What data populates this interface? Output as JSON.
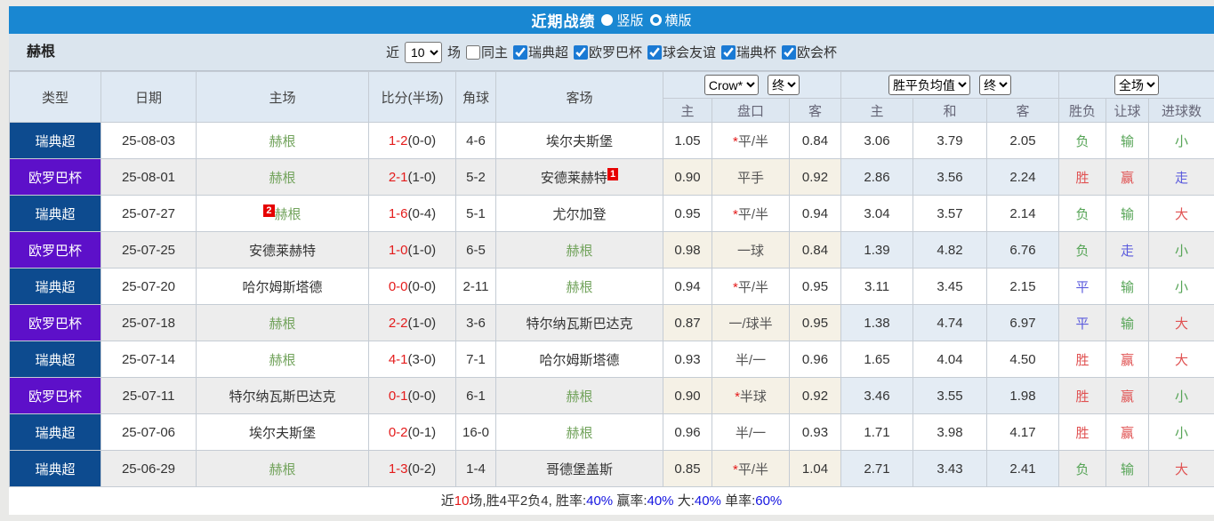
{
  "banner": {
    "title": "近期战绩",
    "vertical_label": "竖版",
    "horizontal_label": "横版"
  },
  "filter": {
    "team": "赫根",
    "near_label": "近",
    "count_value": "10",
    "games_label": "场",
    "same_home_label": "同主",
    "leagues": [
      "瑞典超",
      "欧罗巴杯",
      "球会友谊",
      "瑞典杯",
      "欧会杯"
    ]
  },
  "header": {
    "type": "类型",
    "date": "日期",
    "home": "主场",
    "score": "比分(半场)",
    "corner": "角球",
    "away": "客场",
    "odds_source": "Crow*",
    "asia_period": "终",
    "avg_source": "胜平负均值",
    "avg_period": "终",
    "scope": "全场",
    "sub": {
      "a_home": "主",
      "a_handicap": "盘口",
      "a_away": "客",
      "e_home": "主",
      "e_draw": "和",
      "e_away": "客",
      "wdl": "胜负",
      "let": "让球",
      "goals": "进球数"
    }
  },
  "league_colors": {
    "瑞典超": "#0d4b8f",
    "欧罗巴杯": "#5d10c9"
  },
  "table": {
    "rows": [
      {
        "league": "瑞典超",
        "date": "25-08-03",
        "home": {
          "name": "赫根",
          "is_team": true
        },
        "score": {
          "full": "1-2",
          "half": "(0-0)"
        },
        "corner": "4-6",
        "away": {
          "name": "埃尔夫斯堡",
          "is_team": false
        },
        "asia": {
          "home": "1.05",
          "star": true,
          "handicap": "平/半",
          "away": "0.84"
        },
        "avg": {
          "home": "3.06",
          "draw": "3.79",
          "away": "2.05"
        },
        "result": {
          "wdl": "负",
          "wdl_c": "green",
          "let": "输",
          "let_c": "green",
          "goals": "小",
          "goals_c": "green"
        }
      },
      {
        "league": "欧罗巴杯",
        "date": "25-08-01",
        "home": {
          "name": "赫根",
          "is_team": true
        },
        "score": {
          "full": "2-1",
          "half": "(1-0)"
        },
        "corner": "5-2",
        "away": {
          "name": "安德莱赫特",
          "is_team": false,
          "card": "1",
          "card_pos": "after"
        },
        "asia": {
          "home": "0.90",
          "star": false,
          "handicap": "平手",
          "away": "0.92"
        },
        "avg": {
          "home": "2.86",
          "draw": "3.56",
          "away": "2.24"
        },
        "result": {
          "wdl": "胜",
          "wdl_c": "red",
          "let": "赢",
          "let_c": "red",
          "goals": "走",
          "goals_c": "blue"
        }
      },
      {
        "league": "瑞典超",
        "date": "25-07-27",
        "home": {
          "name": "赫根",
          "is_team": true,
          "card": "2",
          "card_pos": "before"
        },
        "score": {
          "full": "1-6",
          "half": "(0-4)"
        },
        "corner": "5-1",
        "away": {
          "name": "尤尔加登",
          "is_team": false
        },
        "asia": {
          "home": "0.95",
          "star": true,
          "handicap": "平/半",
          "away": "0.94"
        },
        "avg": {
          "home": "3.04",
          "draw": "3.57",
          "away": "2.14"
        },
        "result": {
          "wdl": "负",
          "wdl_c": "green",
          "let": "输",
          "let_c": "green",
          "goals": "大",
          "goals_c": "red"
        }
      },
      {
        "league": "欧罗巴杯",
        "date": "25-07-25",
        "home": {
          "name": "安德莱赫特",
          "is_team": false
        },
        "score": {
          "full": "1-0",
          "half": "(1-0)"
        },
        "corner": "6-5",
        "away": {
          "name": "赫根",
          "is_team": true
        },
        "asia": {
          "home": "0.98",
          "star": false,
          "handicap": "一球",
          "away": "0.84"
        },
        "avg": {
          "home": "1.39",
          "draw": "4.82",
          "away": "6.76"
        },
        "result": {
          "wdl": "负",
          "wdl_c": "green",
          "let": "走",
          "let_c": "blue",
          "goals": "小",
          "goals_c": "green"
        }
      },
      {
        "league": "瑞典超",
        "date": "25-07-20",
        "home": {
          "name": "哈尔姆斯塔德",
          "is_team": false
        },
        "score": {
          "full": "0-0",
          "half": "(0-0)"
        },
        "corner": "2-11",
        "away": {
          "name": "赫根",
          "is_team": true
        },
        "asia": {
          "home": "0.94",
          "star": true,
          "handicap": "平/半",
          "away": "0.95"
        },
        "avg": {
          "home": "3.11",
          "draw": "3.45",
          "away": "2.15"
        },
        "result": {
          "wdl": "平",
          "wdl_c": "blue",
          "let": "输",
          "let_c": "green",
          "goals": "小",
          "goals_c": "green"
        }
      },
      {
        "league": "欧罗巴杯",
        "date": "25-07-18",
        "home": {
          "name": "赫根",
          "is_team": true
        },
        "score": {
          "full": "2-2",
          "half": "(1-0)"
        },
        "corner": "3-6",
        "away": {
          "name": "特尔纳瓦斯巴达克",
          "is_team": false
        },
        "asia": {
          "home": "0.87",
          "star": false,
          "handicap": "一/球半",
          "away": "0.95"
        },
        "avg": {
          "home": "1.38",
          "draw": "4.74",
          "away": "6.97"
        },
        "result": {
          "wdl": "平",
          "wdl_c": "blue",
          "let": "输",
          "let_c": "green",
          "goals": "大",
          "goals_c": "red"
        }
      },
      {
        "league": "瑞典超",
        "date": "25-07-14",
        "home": {
          "name": "赫根",
          "is_team": true
        },
        "score": {
          "full": "4-1",
          "half": "(3-0)"
        },
        "corner": "7-1",
        "away": {
          "name": "哈尔姆斯塔德",
          "is_team": false
        },
        "asia": {
          "home": "0.93",
          "star": false,
          "handicap": "半/一",
          "away": "0.96"
        },
        "avg": {
          "home": "1.65",
          "draw": "4.04",
          "away": "4.50"
        },
        "result": {
          "wdl": "胜",
          "wdl_c": "red",
          "let": "赢",
          "let_c": "red",
          "goals": "大",
          "goals_c": "red"
        }
      },
      {
        "league": "欧罗巴杯",
        "date": "25-07-11",
        "home": {
          "name": "特尔纳瓦斯巴达克",
          "is_team": false
        },
        "score": {
          "full": "0-1",
          "half": "(0-0)"
        },
        "corner": "6-1",
        "away": {
          "name": "赫根",
          "is_team": true
        },
        "asia": {
          "home": "0.90",
          "star": true,
          "handicap": "半球",
          "away": "0.92"
        },
        "avg": {
          "home": "3.46",
          "draw": "3.55",
          "away": "1.98"
        },
        "result": {
          "wdl": "胜",
          "wdl_c": "red",
          "let": "赢",
          "let_c": "red",
          "goals": "小",
          "goals_c": "green"
        }
      },
      {
        "league": "瑞典超",
        "date": "25-07-06",
        "home": {
          "name": "埃尔夫斯堡",
          "is_team": false
        },
        "score": {
          "full": "0-2",
          "half": "(0-1)"
        },
        "corner": "16-0",
        "away": {
          "name": "赫根",
          "is_team": true
        },
        "asia": {
          "home": "0.96",
          "star": false,
          "handicap": "半/一",
          "away": "0.93"
        },
        "avg": {
          "home": "1.71",
          "draw": "3.98",
          "away": "4.17"
        },
        "result": {
          "wdl": "胜",
          "wdl_c": "red",
          "let": "赢",
          "let_c": "red",
          "goals": "小",
          "goals_c": "green"
        }
      },
      {
        "league": "瑞典超",
        "date": "25-06-29",
        "home": {
          "name": "赫根",
          "is_team": true
        },
        "score": {
          "full": "1-3",
          "half": "(0-2)"
        },
        "corner": "1-4",
        "away": {
          "name": "哥德堡盖斯",
          "is_team": false
        },
        "asia": {
          "home": "0.85",
          "star": true,
          "handicap": "平/半",
          "away": "1.04"
        },
        "avg": {
          "home": "2.71",
          "draw": "3.43",
          "away": "2.41"
        },
        "result": {
          "wdl": "负",
          "wdl_c": "green",
          "let": "输",
          "let_c": "green",
          "goals": "大",
          "goals_c": "red"
        }
      }
    ]
  },
  "footer": {
    "near_label": "近",
    "count": "10",
    "summary": "场,胜4平2负4, 胜率:",
    "win_rate": "40%",
    "handicap_label": " 赢率:",
    "handicap_rate": "40%",
    "big_label": " 大:",
    "big_rate": "40%",
    "single_label": " 单率:",
    "single_rate": "60%"
  }
}
